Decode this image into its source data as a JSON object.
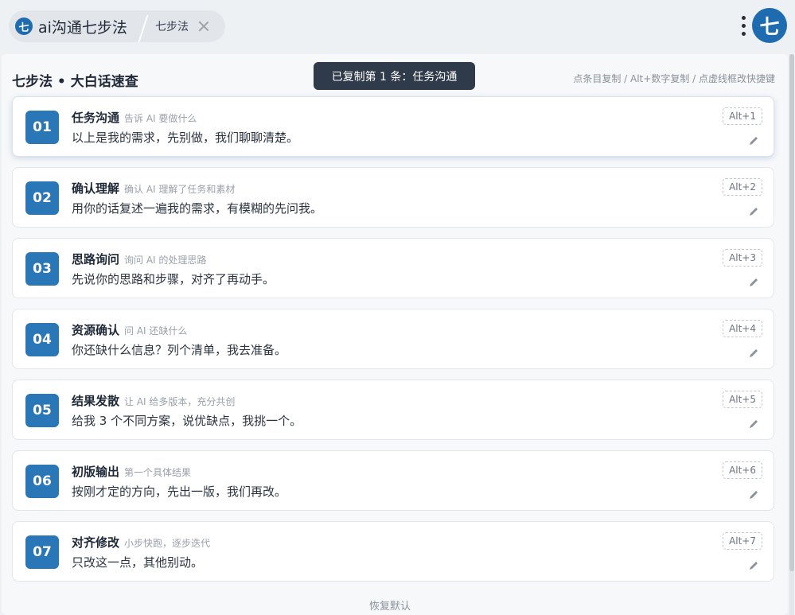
{
  "header": {
    "logo_glyph": "七",
    "app_title": "ai沟通七步法",
    "tab_label": "七步法",
    "avatar_glyph": "七"
  },
  "panel": {
    "title": "七步法 • 大白话速查",
    "toast": "已复制第 1 条：任务沟通",
    "hint": "点条目复制 / Alt+数字复制 / 点虚线框改快捷键",
    "restore": "恢复默认"
  },
  "steps": [
    {
      "num": "01",
      "title": "任务沟通",
      "subtitle": "告诉 AI 要做什么",
      "body": "以上是我的需求，先别做，我们聊聊清楚。",
      "shortcut": "Alt+1"
    },
    {
      "num": "02",
      "title": "确认理解",
      "subtitle": "确认 AI 理解了任务和素材",
      "body": "用你的话复述一遍我的需求，有模糊的先问我。",
      "shortcut": "Alt+2"
    },
    {
      "num": "03",
      "title": "思路询问",
      "subtitle": "询问 AI 的处理思路",
      "body": "先说你的思路和步骤，对齐了再动手。",
      "shortcut": "Alt+3"
    },
    {
      "num": "04",
      "title": "资源确认",
      "subtitle": "问 AI 还缺什么",
      "body": "你还缺什么信息？列个清单，我去准备。",
      "shortcut": "Alt+4"
    },
    {
      "num": "05",
      "title": "结果发散",
      "subtitle": "让 AI 给多版本，充分共创",
      "body": "给我 3 个不同方案，说优缺点，我挑一个。",
      "shortcut": "Alt+5"
    },
    {
      "num": "06",
      "title": "初版输出",
      "subtitle": "第一个具体结果",
      "body": "按刚才定的方向，先出一版，我们再改。",
      "shortcut": "Alt+6"
    },
    {
      "num": "07",
      "title": "对齐修改",
      "subtitle": "小步快跑，逐步迭代",
      "body": "只改这一点，其他别动。",
      "shortcut": "Alt+7"
    }
  ],
  "colors": {
    "accent": "#2a77b8",
    "toast_bg": "#2f3b4a"
  }
}
